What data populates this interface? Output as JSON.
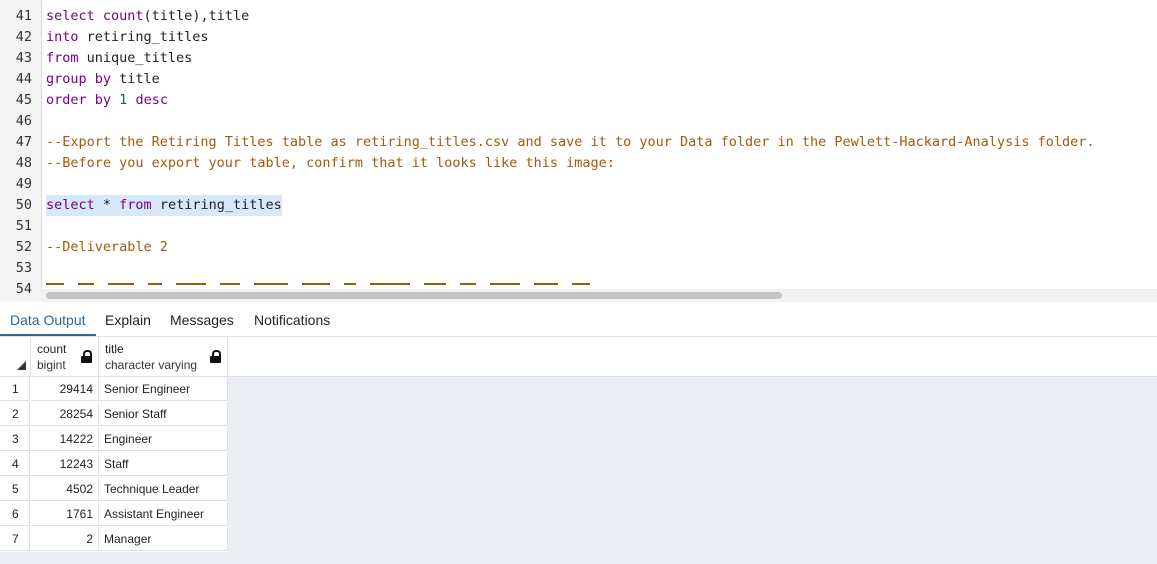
{
  "editor": {
    "lines": [
      {
        "n": "41",
        "tokens": [
          {
            "t": "select count",
            "c": "kw"
          },
          {
            "t": "(title),title",
            "c": ""
          }
        ]
      },
      {
        "n": "42",
        "tokens": [
          {
            "t": "into",
            "c": "kw"
          },
          {
            "t": " retiring_titles",
            "c": ""
          }
        ]
      },
      {
        "n": "43",
        "tokens": [
          {
            "t": "from",
            "c": "kw"
          },
          {
            "t": " unique_titles",
            "c": ""
          }
        ]
      },
      {
        "n": "44",
        "tokens": [
          {
            "t": "group by",
            "c": "kw"
          },
          {
            "t": " title",
            "c": ""
          }
        ]
      },
      {
        "n": "45",
        "tokens": [
          {
            "t": "order by",
            "c": "kw"
          },
          {
            "t": " ",
            "c": ""
          },
          {
            "t": "1",
            "c": "num"
          },
          {
            "t": " ",
            "c": ""
          },
          {
            "t": "desc",
            "c": "kw"
          }
        ]
      },
      {
        "n": "46",
        "tokens": []
      },
      {
        "n": "47",
        "tokens": [
          {
            "t": "--Export the Retiring Titles table as retiring_titles.csv and save it to your Data folder in the Pewlett-Hackard-Analysis folder.",
            "c": "cm"
          }
        ]
      },
      {
        "n": "48",
        "tokens": [
          {
            "t": "--Before you export your table, confirm that it looks like this image:",
            "c": "cm"
          }
        ]
      },
      {
        "n": "49",
        "tokens": []
      },
      {
        "n": "50",
        "selected": true,
        "tokens": [
          {
            "t": "select",
            "c": "kw"
          },
          {
            "t": " * ",
            "c": ""
          },
          {
            "t": "from",
            "c": "kw"
          },
          {
            "t": " retiring_titles",
            "c": ""
          }
        ]
      },
      {
        "n": "51",
        "tokens": []
      },
      {
        "n": "52",
        "tokens": [
          {
            "t": "--Deliverable 2",
            "c": "cm"
          }
        ]
      },
      {
        "n": "53",
        "tokens": []
      },
      {
        "n": "54",
        "tokens": []
      }
    ]
  },
  "tabs": [
    {
      "label": "Data Output",
      "active": true
    },
    {
      "label": "Explain",
      "active": false
    },
    {
      "label": "Messages",
      "active": false
    },
    {
      "label": "Notifications",
      "active": false
    }
  ],
  "grid": {
    "columns": [
      {
        "name": "count",
        "type": "bigint",
        "icon": "lock-icon"
      },
      {
        "name": "title",
        "type": "character varying",
        "icon": "lock-icon"
      }
    ],
    "rows": [
      {
        "n": "1",
        "count": "29414",
        "title": "Senior Engineer"
      },
      {
        "n": "2",
        "count": "28254",
        "title": "Senior Staff"
      },
      {
        "n": "3",
        "count": "14222",
        "title": "Engineer"
      },
      {
        "n": "4",
        "count": "12243",
        "title": "Staff"
      },
      {
        "n": "5",
        "count": "4502",
        "title": "Technique Leader"
      },
      {
        "n": "6",
        "count": "1761",
        "title": "Assistant Engineer"
      },
      {
        "n": "7",
        "count": "2",
        "title": "Manager"
      }
    ]
  },
  "colors": {
    "keyword": "#770088",
    "comment": "#a25a0c",
    "number": "#116644",
    "active_tab": "#326690",
    "selection": "#d7e8fa"
  }
}
